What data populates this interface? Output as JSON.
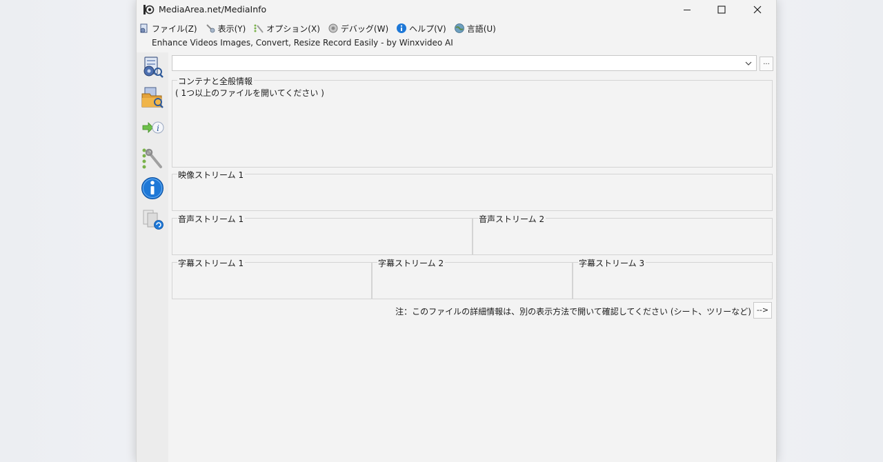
{
  "window": {
    "title": "MediaArea.net/MediaInfo",
    "minimize_icon": "minimize-icon",
    "maximize_icon": "maximize-icon",
    "close_icon": "close-icon"
  },
  "menu": [
    {
      "label": "ファイル(Z)",
      "icon": "file-icon"
    },
    {
      "label": "表示(Y)",
      "icon": "view-icon"
    },
    {
      "label": "オプション(X)",
      "icon": "options-icon"
    },
    {
      "label": "デバッグ(W)",
      "icon": "debug-icon"
    },
    {
      "label": "ヘルプ(V)",
      "icon": "help-icon"
    },
    {
      "label": "言語(U)",
      "icon": "language-icon"
    }
  ],
  "ad_text": "Enhance Videos  Images, Convert, Resize  Record Easily - by Winxvideo AI",
  "toolbar": [
    {
      "icon": "open-file-icon"
    },
    {
      "icon": "open-folder-icon"
    },
    {
      "icon": "export-info-icon"
    },
    {
      "icon": "preferences-icon"
    },
    {
      "icon": "about-info-icon"
    },
    {
      "icon": "check-update-icon"
    }
  ],
  "file_selector": {
    "value": "",
    "browse_label": "..."
  },
  "groups": {
    "general": {
      "title": "コンテナと全般情報",
      "body": "( 1つ以上のファイルを開いてください )"
    },
    "video1": {
      "title": "映像ストリーム 1"
    },
    "audio1": {
      "title": "音声ストリーム 1"
    },
    "audio2": {
      "title": "音声ストリーム 2"
    },
    "text1": {
      "title": "字幕ストリーム 1"
    },
    "text2": {
      "title": "字幕ストリーム 2"
    },
    "text3": {
      "title": "字幕ストリーム 3"
    }
  },
  "note": "注：このファイルの詳細情報は、別の表示方法で開いて確認してください (シート、ツリーなど)",
  "next_button_label": "-->",
  "colors": {
    "window_bg": "#f3f3f3",
    "toolbar_bg": "#ececec",
    "border": "#d4d4d4",
    "accent_blue": "#1e78d7"
  }
}
